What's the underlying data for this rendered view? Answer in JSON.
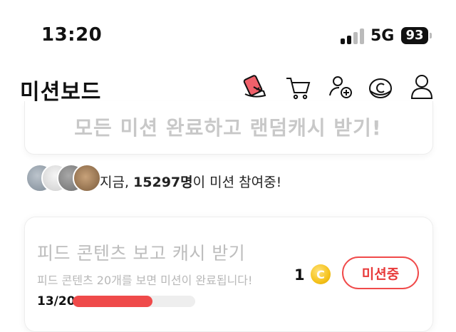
{
  "status_bar": {
    "time": "13:20",
    "network": "5G",
    "battery": "93"
  },
  "header": {
    "title": "미션보드",
    "icons": [
      "mission-shoe-icon",
      "cart-icon",
      "add-friend-icon",
      "coin-c-icon",
      "profile-icon"
    ]
  },
  "banner": {
    "text": "모든 미션 완료하고 랜덤캐시 받기!"
  },
  "participants": {
    "prefix": "지금, ",
    "count": "15297명",
    "suffix": "이 미션 참여중!"
  },
  "mission": {
    "title": "피드 콘텐츠 보고 캐시 받기",
    "description": "피드 콘텐츠 20개를 보면 미션이 완료됩니다!",
    "reward": "1",
    "coin_symbol": "C",
    "button_label": "미션중",
    "progress_text": "13/20",
    "progress_current": 13,
    "progress_total": 20
  },
  "colors": {
    "accent": "#ef4a4a",
    "coin": "#f5c21b",
    "muted_text": "#bdbdbd"
  }
}
